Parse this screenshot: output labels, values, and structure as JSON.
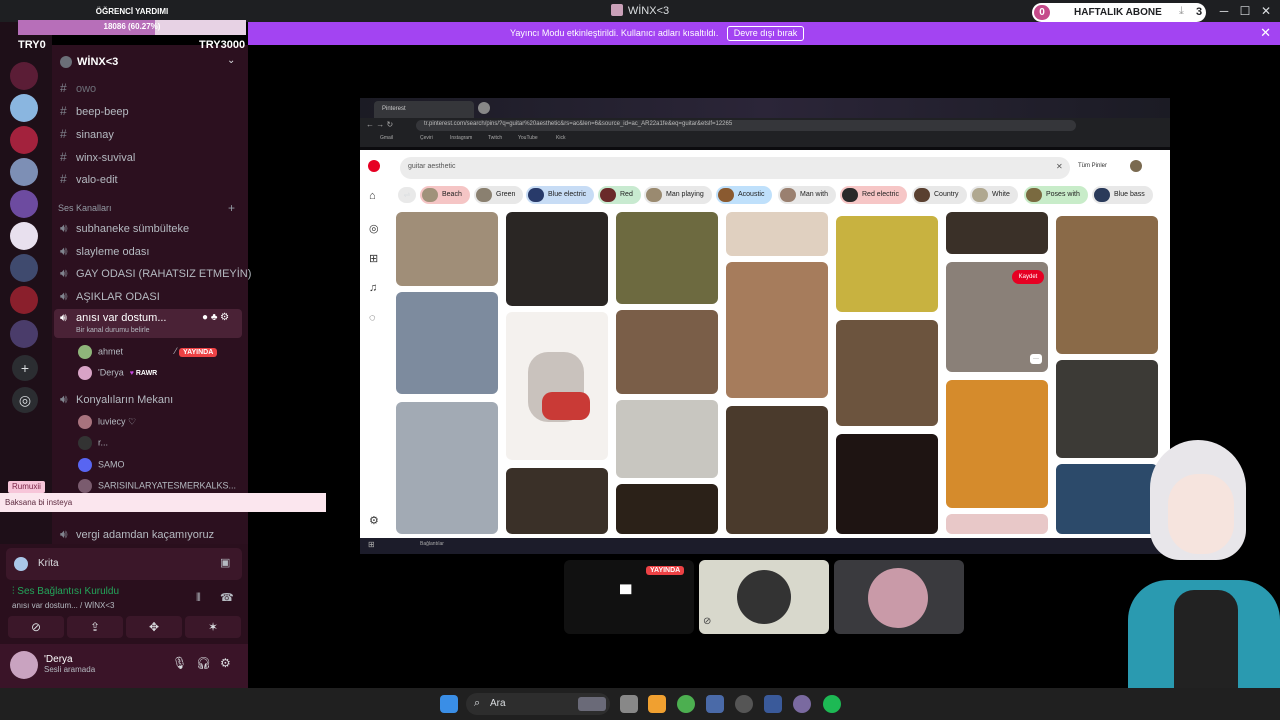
{
  "window": {
    "title": "WİNX<3"
  },
  "overlay": {
    "goal_label": "ÖĞRENCİ YARDIMI",
    "goal_progress_text": "18086 (60.27%)",
    "goal_progress": 0.6027,
    "goal_min": "TRY0",
    "goal_max": "TRY3000",
    "sub_count": "0",
    "sub_label": "HAFTALIK ABONE",
    "sub_goal": "3",
    "alert_name": "Rumuxii",
    "alert_message": "Baksana bi insteya"
  },
  "banner": {
    "text": "Yayıncı Modu etkinleştirildi. Kullanıcı adları kısaltıldı.",
    "button": "Devre dışı bırak"
  },
  "sidebar": {
    "server_name": "WİNX<3",
    "text_channels": [
      "owo",
      "beep-beep",
      "sinanay",
      "winx-suvival",
      "valo-edit"
    ],
    "voice_category": "Ses Kanalları",
    "voice_channels": [
      "subhaneke sümbülteke",
      "slayleme odası",
      "GAY ODASI (RAHATSIZ ETMEYİN)",
      "AŞIKLAR ODASI"
    ],
    "active_voice": {
      "name": "anısı var dostum...",
      "status": "Bir kanal durumu belirle"
    },
    "active_users": [
      {
        "name": "ahmet",
        "badge": "YAYINDA"
      },
      {
        "name": "'Derya",
        "badge": "RAWR"
      }
    ],
    "other_voice": "Konyalıların Mekanı",
    "other_users": [
      "luviecy ♡",
      "r...",
      "SAMO",
      "SARISINLARYATESMERKALKS..."
    ],
    "last_channel": "vergi adamdan kaçamıyoruz"
  },
  "rtc": {
    "activity_name": "Krita",
    "status": "Ses Bağlantısı Kuruldu",
    "channel": "anısı var dostum... / WİNX<3"
  },
  "user": {
    "name": "'Derya",
    "status": "Sesli aramada"
  },
  "stream": {
    "url": "tr.pinterest.com/search/pins/?q=guitar%20aesthetic&rs=ac&len=6&source_id=ac_AR22a1fe&eq=guitar&etslf=12265",
    "search": "guitar aesthetic",
    "filter": "Tüm Pinler",
    "chips": [
      "Beach",
      "Green",
      "Blue electric",
      "Red",
      "Man playing",
      "Acoustic",
      "Man with",
      "Red electric",
      "Country",
      "White",
      "Poses with",
      "Blue bass"
    ],
    "save_button": "Kaydet",
    "bookmarks": [
      "Gmail",
      "Çeviri",
      "Instagram",
      "Twitch",
      "YouTube",
      "Kick"
    ],
    "inner_taskbar_label": "Bağlantılar"
  },
  "tiles": {
    "live_badge": "YAYINDA"
  },
  "taskbar": {
    "search": "Ara"
  }
}
